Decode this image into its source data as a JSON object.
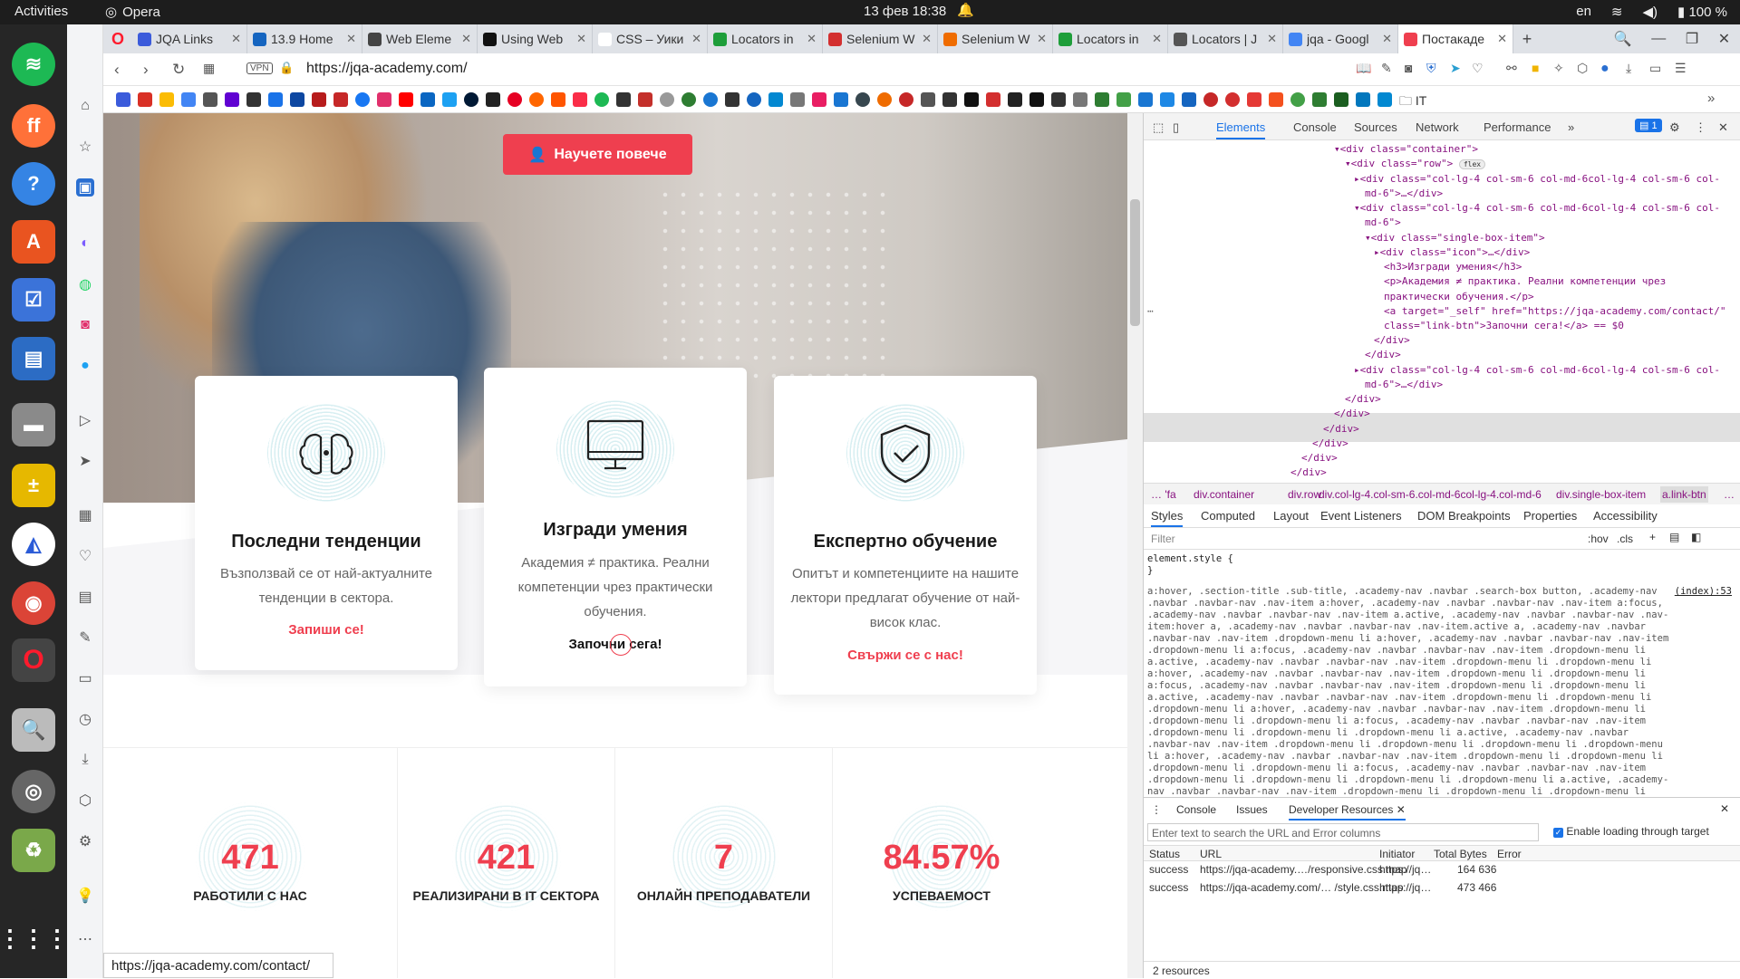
{
  "os": {
    "activities": "Activities",
    "app": "Opera",
    "clock": "13 фев  18:38",
    "lang": "en",
    "battery": "100 %"
  },
  "tabs": [
    {
      "title": "JQA Links",
      "color": "#3b5bdb"
    },
    {
      "title": "13.9 Home",
      "color": "#1565c0"
    },
    {
      "title": "Web Eleme",
      "color": "#444"
    },
    {
      "title": "Using Web",
      "color": "#111"
    },
    {
      "title": "CSS – Уики",
      "color": "#fff"
    },
    {
      "title": "Locators in",
      "color": "#1e9e3a"
    },
    {
      "title": "Selenium W",
      "color": "#d32f2f"
    },
    {
      "title": "Selenium W",
      "color": "#ef6c00"
    },
    {
      "title": "Locators in",
      "color": "#1e9e3a"
    },
    {
      "title": "Locators | J",
      "color": "#555"
    },
    {
      "title": "jqa - Googl",
      "color": "#4285f4"
    },
    {
      "title": "Постакаде",
      "color": "#ef3f4f"
    }
  ],
  "address": {
    "vpn": "VPN",
    "url": "https://jqa-academy.com/"
  },
  "bookmarks": {
    "last": "IT"
  },
  "hero": {
    "cta": "Научете повече"
  },
  "cards": [
    {
      "title": "Последни тенденции",
      "text": "Възползвай се от най-актуалните тенденции в сектора.",
      "link": "Запиши се!"
    },
    {
      "title": "Изгради умения",
      "text": "Академия ≠ практика. Реални компетенции чрез практически обучения.",
      "link": "Започни сега!"
    },
    {
      "title": "Експертно обучение",
      "text": "Опитът и компетенциите на нашите лектори предлагат обучение от най-висок клас.",
      "link": "Свържи се с нас!"
    }
  ],
  "stats": [
    {
      "num": "471",
      "label": "РАБОТИЛИ С НАС"
    },
    {
      "num": "421",
      "label": "РЕАЛИЗИРАНИ В IT СЕКТОРА"
    },
    {
      "num": "7",
      "label": "ОНЛАЙН ПРЕПОДАВАТЕЛИ"
    },
    {
      "num": "84.57%",
      "label": "УСПЕВАЕМОСТ"
    }
  ],
  "statusbar": "https://jqa-academy.com/contact/",
  "devtools": {
    "tabs": [
      "Elements",
      "Console",
      "Sources",
      "Network",
      "Performance"
    ],
    "issues": "1",
    "dom": [
      "<div class=\"container\">",
      "<div class=\"row\">",
      "<div class=\"col-lg-4 col-sm-6 col-md-6col-lg-4 col-sm-6 col-",
      "md-6\">…</div>",
      "<div class=\"col-lg-4 col-sm-6 col-md-6col-lg-4 col-sm-6 col-",
      "md-6\">",
      "<div class=\"single-box-item\">",
      "<div class=\"icon\">…</div>",
      "<h3>Изгради умения</h3>",
      "<p>Академия ≠ практика. Реални компетенции чрез",
      "практически обучения.</p>",
      "<a target=\"_self\" href=\"https://jqa-academy.com/contact/\"",
      "class=\"link-btn\">Започни сега!</a> == $0",
      "</div>",
      "</div>",
      "<div class=\"col-lg-4 col-sm-6 col-md-6col-lg-4 col-sm-6 col-",
      "md-6\">…</div>",
      "</div>",
      "</div>",
      "</div>",
      "</div>",
      "</div>",
      "</div>"
    ],
    "flex_badge": "flex",
    "breadcrumb": [
      "…  'fa",
      "div.container",
      "div.row",
      "div.col-lg-4.col-sm-6.col-md-6col-lg-4.col-md-6",
      "div.single-box-item",
      "a.link-btn",
      "…"
    ],
    "style_tabs": [
      "Styles",
      "Computed",
      "Layout",
      "Event Listeners",
      "DOM Breakpoints",
      "Properties",
      "Accessibility"
    ],
    "filter": "Filter",
    "hov": ":hov",
    "cls": ".cls",
    "element_style": "element.style {",
    "element_close": "}",
    "rule_source": "(index):53",
    "selectors": "a:hover, .section-title .sub-title, .academy-nav .navbar .search-box button, .academy-nav .navbar .navbar-nav .nav-item a:hover, .academy-nav .navbar .navbar-nav .nav-item a:focus, .academy-nav .navbar .navbar-nav .nav-item a.active, .academy-nav .navbar .navbar-nav .nav-item:hover a, .academy-nav .navbar .navbar-nav .nav-item.active a, .academy-nav .navbar .navbar-nav .nav-item .dropdown-menu li a:hover, .academy-nav .navbar .navbar-nav .nav-item .dropdown-menu li a:focus, .academy-nav .navbar .navbar-nav .nav-item .dropdown-menu li a.active, .academy-nav .navbar .navbar-nav .nav-item .dropdown-menu li .dropdown-menu li a:hover, .academy-nav .navbar .navbar-nav .nav-item .dropdown-menu li .dropdown-menu li a:focus, .academy-nav .navbar .navbar-nav .nav-item .dropdown-menu li .dropdown-menu li a.active, .academy-nav .navbar .navbar-nav .nav-item .dropdown-menu li .dropdown-menu li .dropdown-menu li a:hover, .academy-nav .navbar .navbar-nav .nav-item .dropdown-menu li .dropdown-menu li .dropdown-menu li a:focus, .academy-nav .navbar .navbar-nav .nav-item .dropdown-menu li .dropdown-menu li .dropdown-menu li a.active, .academy-nav .navbar .navbar-nav .nav-item .dropdown-menu li .dropdown-menu li .dropdown-menu li .dropdown-menu li a:hover, .academy-nav .navbar .navbar-nav .nav-item .dropdown-menu li .dropdown-menu li .dropdown-menu li .dropdown-menu li a:focus, .academy-nav .navbar .navbar-nav .nav-item .dropdown-menu li .dropdown-menu li .dropdown-menu li .dropdown-menu li a.active, .academy-nav .navbar .navbar-nav .nav-item .dropdown-menu li .dropdown-menu li .dropdown-menu li .dropdown-menu li .dropdown-menu li a:hover",
    "drawer": {
      "tabs": [
        "Console",
        "Issues",
        "Developer Resources"
      ],
      "search_placeholder": "Enter text to search the URL and Error columns",
      "checkbox": "Enable loading through target",
      "columns": [
        "Status",
        "URL",
        "Initiator",
        "Total Bytes",
        "Error"
      ],
      "rows": [
        {
          "status": "success",
          "url": "https://jqa-academy.…/responsive.css.map",
          "initiator": "https://jq…",
          "bytes": "164 636",
          "error": ""
        },
        {
          "status": "success",
          "url": "https://jqa-academy.com/… /style.css.map",
          "initiator": "https://jq…",
          "bytes": "473 466",
          "error": ""
        }
      ],
      "footer": "2 resources"
    }
  }
}
